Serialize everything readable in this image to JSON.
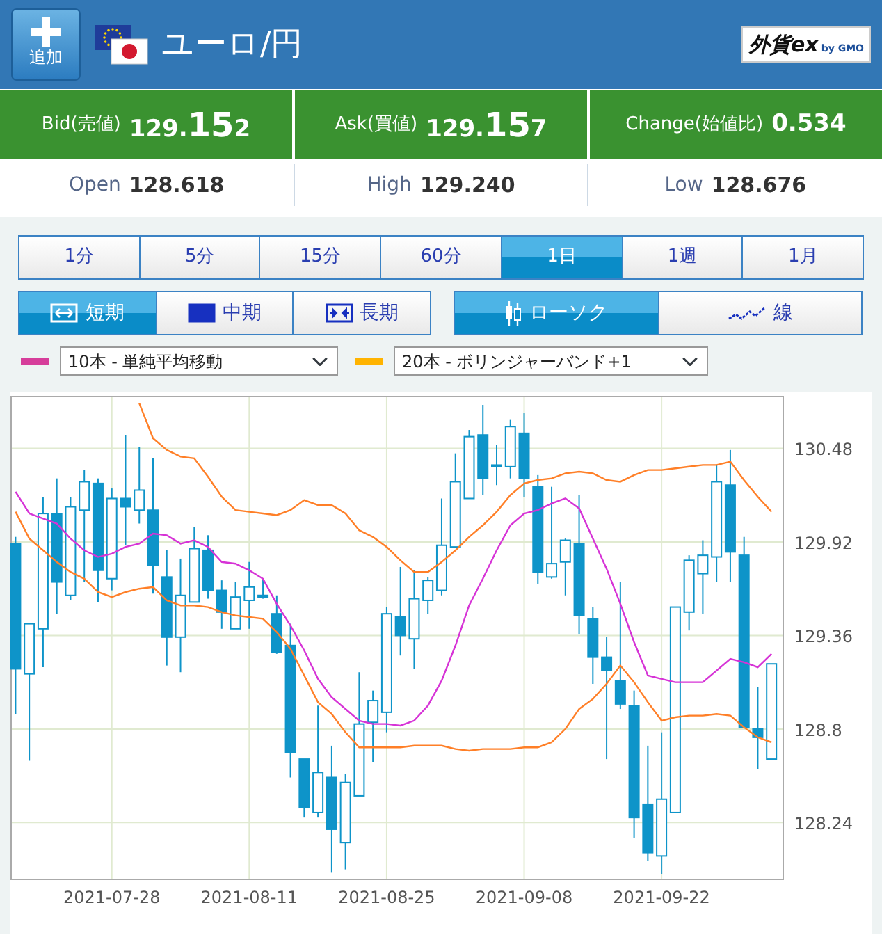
{
  "header": {
    "add_button": "追加",
    "title": "ユーロ/円",
    "logo": {
      "brand": "外貨ex",
      "by": "by GMO"
    }
  },
  "quotes": [
    {
      "label": "Bid(売値)",
      "price": {
        "head": "129.",
        "big": "15",
        "tail": "2"
      }
    },
    {
      "label": "Ask(買値)",
      "price": {
        "head": "129.",
        "big": "15",
        "tail": "7"
      }
    },
    {
      "label": "Change(始値比)",
      "price": {
        "head": "0.534"
      }
    }
  ],
  "stats": [
    {
      "label": "Open",
      "value": "128.618"
    },
    {
      "label": "High",
      "value": "129.240"
    },
    {
      "label": "Low",
      "value": "128.676"
    }
  ],
  "timeframes": [
    {
      "label": "1分",
      "selected": false
    },
    {
      "label": "5分",
      "selected": false
    },
    {
      "label": "15分",
      "selected": false
    },
    {
      "label": "60分",
      "selected": false
    },
    {
      "label": "1日",
      "selected": true
    },
    {
      "label": "1週",
      "selected": false
    },
    {
      "label": "1月",
      "selected": false
    }
  ],
  "periods": [
    {
      "label": "短期",
      "kind": "short",
      "selected": true
    },
    {
      "label": "中期",
      "kind": "medium",
      "selected": false
    },
    {
      "label": "長期",
      "kind": "long",
      "selected": false
    }
  ],
  "chart_types": [
    {
      "label": "ローソク",
      "kind": "candle",
      "selected": true
    },
    {
      "label": "線",
      "kind": "line",
      "selected": false
    }
  ],
  "indicators": [
    {
      "value": "10本 - 単純平均移動",
      "color": "#d63d9a"
    },
    {
      "value": "20本 - ボリンジャーバンド+1",
      "color": "#ffb300"
    }
  ],
  "chart": {
    "chart_data": {
      "type": "candlestick",
      "grid": true,
      "ylim": [
        127.9,
        130.79
      ],
      "categories": [
        null,
        null,
        null,
        null,
        null,
        null,
        null,
        "2021-07-28",
        null,
        null,
        null,
        null,
        null,
        null,
        null,
        null,
        null,
        "2021-08-11",
        null,
        null,
        null,
        null,
        null,
        null,
        null,
        null,
        null,
        "2021-08-25",
        null,
        null,
        null,
        null,
        null,
        null,
        null,
        null,
        null,
        "2021-09-08",
        null,
        null,
        null,
        null,
        null,
        null,
        null,
        null,
        null,
        "2021-09-22",
        null,
        null,
        null,
        null,
        null,
        null,
        null,
        null
      ],
      "yticks": [
        {
          "value": 128.24,
          "label": "128.24"
        },
        {
          "value": 128.8,
          "label": "128.8"
        },
        {
          "value": 129.36,
          "label": "129.36"
        },
        {
          "value": 129.92,
          "label": "129.92"
        },
        {
          "value": 130.48,
          "label": "130.48"
        }
      ],
      "color": "#0e94c9",
      "ohlc": [
        [
          129.91,
          129.95,
          128.89,
          129.16
        ],
        [
          129.13,
          129.43,
          128.61,
          129.43
        ],
        [
          129.4,
          130.19,
          129.17,
          130.09
        ],
        [
          130.09,
          130.3,
          129.49,
          129.68
        ],
        [
          129.6,
          130.19,
          129.57,
          130.13
        ],
        [
          130.11,
          130.35,
          129.68,
          130.28
        ],
        [
          130.27,
          130.3,
          129.56,
          129.75
        ],
        [
          129.7,
          130.24,
          129.63,
          130.18
        ],
        [
          130.18,
          130.56,
          129.9,
          130.13
        ],
        [
          130.11,
          130.49,
          130.03,
          130.23
        ],
        [
          130.11,
          130.42,
          129.61,
          129.78
        ],
        [
          129.71,
          129.87,
          129.18,
          129.35
        ],
        [
          129.35,
          129.82,
          129.14,
          129.6
        ],
        [
          129.56,
          130.01,
          129.56,
          129.88
        ],
        [
          129.87,
          129.96,
          129.58,
          129.63
        ],
        [
          129.63,
          129.69,
          129.4,
          129.5
        ],
        [
          129.4,
          129.68,
          129.4,
          129.59
        ],
        [
          129.57,
          129.8,
          129.4,
          129.65
        ],
        [
          129.6,
          129.7,
          129.58,
          129.59
        ],
        [
          129.49,
          129.6,
          129.25,
          129.26
        ],
        [
          129.3,
          129.43,
          128.51,
          128.66
        ],
        [
          128.62,
          128.62,
          128.27,
          128.33
        ],
        [
          128.3,
          128.94,
          128.27,
          128.54
        ],
        [
          128.51,
          128.7,
          127.94,
          128.2
        ],
        [
          128.12,
          128.53,
          127.96,
          128.48
        ],
        [
          128.4,
          129.14,
          128.4,
          128.83
        ],
        [
          128.84,
          129.03,
          128.6,
          128.97
        ],
        [
          128.9,
          129.53,
          128.78,
          129.49
        ],
        [
          129.47,
          129.77,
          129.24,
          129.36
        ],
        [
          129.34,
          129.75,
          129.16,
          129.58
        ],
        [
          129.57,
          129.71,
          129.49,
          129.69
        ],
        [
          129.63,
          130.18,
          129.6,
          129.9
        ],
        [
          129.89,
          130.45,
          129.89,
          130.28
        ],
        [
          130.18,
          130.59,
          130.18,
          130.55
        ],
        [
          130.56,
          130.74,
          130.2,
          130.3
        ],
        [
          130.38,
          130.5,
          130.26,
          130.37
        ],
        [
          130.37,
          130.65,
          130.3,
          130.61
        ],
        [
          130.57,
          130.69,
          130.19,
          130.3
        ],
        [
          130.25,
          130.32,
          129.67,
          129.74
        ],
        [
          129.71,
          130.25,
          129.7,
          129.79
        ],
        [
          129.8,
          129.94,
          129.6,
          129.93
        ],
        [
          129.91,
          130.2,
          129.37,
          129.48
        ],
        [
          129.46,
          129.53,
          129.07,
          129.23
        ],
        [
          129.23,
          129.35,
          128.62,
          129.15
        ],
        [
          129.09,
          129.68,
          128.92,
          128.95
        ],
        [
          128.94,
          129.03,
          128.15,
          128.27
        ],
        [
          128.35,
          128.7,
          128.01,
          128.06
        ],
        [
          128.04,
          128.78,
          127.93,
          128.38
        ],
        [
          128.3,
          129.53,
          128.3,
          129.53
        ],
        [
          129.5,
          129.84,
          129.39,
          129.81
        ],
        [
          129.73,
          129.93,
          129.49,
          129.84
        ],
        [
          129.83,
          130.38,
          129.68,
          130.28
        ],
        [
          130.26,
          130.47,
          129.68,
          129.86
        ],
        [
          129.84,
          129.95,
          128.81,
          128.81
        ],
        [
          128.8,
          129.05,
          128.56,
          128.75
        ],
        [
          128.62,
          129.19,
          128.62,
          129.19
        ]
      ],
      "series": [
        {
          "type": "line",
          "color": "#d633d6",
          "values": [
            130.22,
            130.09,
            130.06,
            130.03,
            129.94,
            129.87,
            129.83,
            129.85,
            129.89,
            129.91,
            129.97,
            129.96,
            129.91,
            129.93,
            129.89,
            129.8,
            129.79,
            129.75,
            129.7,
            129.55,
            129.42,
            129.27,
            129.1,
            128.99,
            128.92,
            128.85,
            128.83,
            128.83,
            128.82,
            128.85,
            128.94,
            129.09,
            129.3,
            129.54,
            129.7,
            129.87,
            130.02,
            130.09,
            130.11,
            130.15,
            130.18,
            130.12,
            129.94,
            129.76,
            129.55,
            129.32,
            129.12,
            129.1,
            129.08,
            129.08,
            129.08,
            129.15,
            129.22,
            129.2,
            129.17,
            129.25
          ]
        },
        {
          "type": "line",
          "color": "#ff7f27",
          "values": [
            null,
            null,
            null,
            null,
            null,
            null,
            null,
            null,
            null,
            130.75,
            130.54,
            130.47,
            130.43,
            130.42,
            130.31,
            130.19,
            130.11,
            130.1,
            130.09,
            130.08,
            130.11,
            130.17,
            130.14,
            130.14,
            130.09,
            129.99,
            129.95,
            129.89,
            129.81,
            129.74,
            129.74,
            129.8,
            129.87,
            129.95,
            130.02,
            130.1,
            130.2,
            130.27,
            130.29,
            130.3,
            130.33,
            130.34,
            130.33,
            130.29,
            130.28,
            130.32,
            130.35,
            130.35,
            130.36,
            130.37,
            130.38,
            130.38,
            130.4,
            130.29,
            130.19,
            130.1
          ]
        },
        {
          "type": "line",
          "color": "#ff7f27",
          "values": [
            130.1,
            129.94,
            129.87,
            129.8,
            129.74,
            129.7,
            129.62,
            129.59,
            129.62,
            129.64,
            129.65,
            129.57,
            129.54,
            129.54,
            129.53,
            129.5,
            129.48,
            129.47,
            129.46,
            129.38,
            129.28,
            129.12,
            128.96,
            128.89,
            128.78,
            128.69,
            128.69,
            128.69,
            128.69,
            128.7,
            128.7,
            128.7,
            128.68,
            128.67,
            128.68,
            128.68,
            128.68,
            128.69,
            128.69,
            128.72,
            128.8,
            128.92,
            128.98,
            129.07,
            129.18,
            129.08,
            128.96,
            128.85,
            128.87,
            128.88,
            128.88,
            128.89,
            128.88,
            128.81,
            128.75,
            128.72
          ]
        }
      ]
    }
  }
}
